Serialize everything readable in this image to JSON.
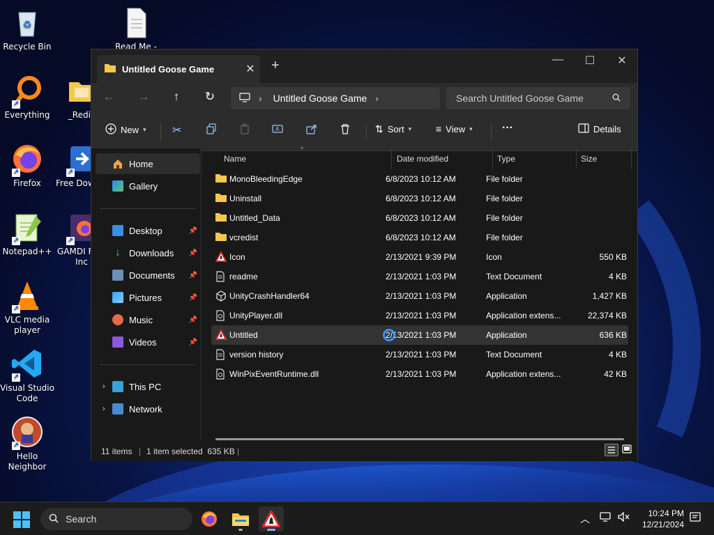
{
  "desktop": {
    "icons": [
      {
        "label": "Recycle Bin"
      },
      {
        "label": "Read Me -"
      },
      {
        "label": "Everything"
      },
      {
        "label": "_Redis"
      },
      {
        "label": "Firefox"
      },
      {
        "label": "Free Downlo"
      },
      {
        "label": "Notepad++"
      },
      {
        "label": "GAMDI Free Inc"
      },
      {
        "label": "VLC media player"
      },
      {
        "label": "Visual Studio Code"
      },
      {
        "label": "Hello Neighbor"
      }
    ]
  },
  "window": {
    "tab_title": "Untitled Goose Game",
    "breadcrumb": "Untitled Goose Game",
    "search_placeholder": "Search Untitled Goose Game",
    "toolbar": {
      "new_label": "New",
      "sort_label": "Sort",
      "view_label": "View",
      "more_label": "···",
      "details_label": "Details"
    },
    "nav": {
      "home": "Home",
      "gallery": "Gallery",
      "desktop": "Desktop",
      "downloads": "Downloads",
      "documents": "Documents",
      "pictures": "Pictures",
      "music": "Music",
      "videos": "Videos",
      "this_pc": "This PC",
      "network": "Network"
    },
    "columns": {
      "name": "Name",
      "date": "Date modified",
      "type": "Type",
      "size": "Size"
    },
    "files": [
      {
        "name": "MonoBleedingEdge",
        "date": "6/8/2023 10:12 AM",
        "type": "File folder",
        "size": "",
        "kind": "folder"
      },
      {
        "name": "Uninstall",
        "date": "6/8/2023 10:12 AM",
        "type": "File folder",
        "size": "",
        "kind": "folder"
      },
      {
        "name": "Untitled_Data",
        "date": "6/8/2023 10:12 AM",
        "type": "File folder",
        "size": "",
        "kind": "folder"
      },
      {
        "name": "vcredist",
        "date": "6/8/2023 10:12 AM",
        "type": "File folder",
        "size": "",
        "kind": "folder"
      },
      {
        "name": "Icon",
        "date": "2/13/2021 9:39 PM",
        "type": "Icon",
        "size": "550 KB",
        "kind": "goose"
      },
      {
        "name": "readme",
        "date": "2/13/2021 1:03 PM",
        "type": "Text Document",
        "size": "4 KB",
        "kind": "doc"
      },
      {
        "name": "UnityCrashHandler64",
        "date": "2/13/2021 1:03 PM",
        "type": "Application",
        "size": "1,427 KB",
        "kind": "unity"
      },
      {
        "name": "UnityPlayer.dll",
        "date": "2/13/2021 1:03 PM",
        "type": "Application extens...",
        "size": "22,374 KB",
        "kind": "dll"
      },
      {
        "name": "Untitled",
        "date": "2/13/2021 1:03 PM",
        "type": "Application",
        "size": "636 KB",
        "kind": "goose",
        "selected": true
      },
      {
        "name": "version history",
        "date": "2/13/2021 1:03 PM",
        "type": "Text Document",
        "size": "4 KB",
        "kind": "doc"
      },
      {
        "name": "WinPixEventRuntime.dll",
        "date": "2/13/2021 1:03 PM",
        "type": "Application extens...",
        "size": "42 KB",
        "kind": "dll"
      }
    ],
    "status": {
      "items": "11 items",
      "selected": "1 item selected  635 KB"
    }
  },
  "taskbar": {
    "search_label": "Search",
    "time": "10:24 PM",
    "date": "12/21/2024"
  },
  "colors": {
    "folder": "#f3c84b",
    "accent": "#4c9bff"
  }
}
